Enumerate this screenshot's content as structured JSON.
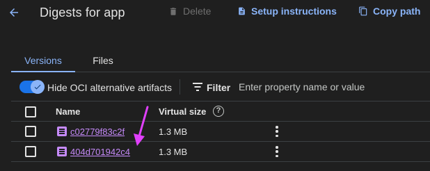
{
  "header": {
    "title": "Digests for app",
    "delete_label": "Delete",
    "setup_label": "Setup instructions",
    "copy_label": "Copy path"
  },
  "tabs": [
    {
      "label": "Versions",
      "active": true
    },
    {
      "label": "Files",
      "active": false
    }
  ],
  "toolbar": {
    "hide_oci_label": "Hide OCI alternative artifacts",
    "hide_oci_enabled": true,
    "filter_label": "Filter",
    "filter_placeholder": "Enter property name or value"
  },
  "table": {
    "columns": [
      "Name",
      "Virtual size"
    ],
    "rows": [
      {
        "name": "c02779f83c2f",
        "size": "1.3 MB"
      },
      {
        "name": "404d701942c4",
        "size": "1.3 MB"
      }
    ]
  },
  "colors": {
    "accent": "#8ab4f8",
    "link": "#c58af9",
    "annotation_arrow": "#e040fb",
    "background": "#1f1f1f"
  }
}
